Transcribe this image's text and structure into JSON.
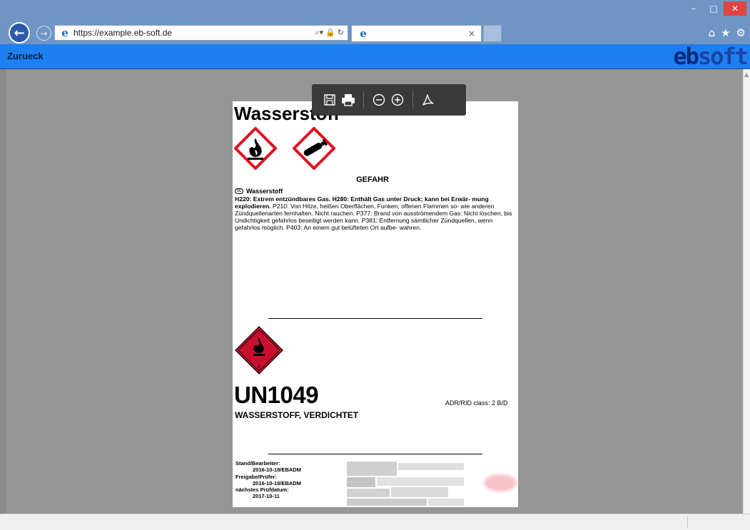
{
  "browser": {
    "url": "https://example.eb-soft.de",
    "tab_title": "",
    "window_buttons": {
      "minimize": "–",
      "maximize": "□",
      "close": "✕"
    },
    "tool_icons": [
      "home-icon",
      "star-icon",
      "gear-icon"
    ]
  },
  "app": {
    "back_label": "Zurueck",
    "brand": {
      "part1": "eb",
      "part2": "soft"
    },
    "accent_color": "#1e7ff0"
  },
  "pdf_toolbar": {
    "buttons": [
      "save-icon",
      "print-icon",
      "zoom-out-icon",
      "zoom-in-icon",
      "acrobat-icon"
    ]
  },
  "document": {
    "title": "Wasserstoff",
    "signal_word": "GEFAHR",
    "lang_badge": "DE",
    "substance": "Wasserstoff",
    "hazard_bold": "H220: Extrem entzündbares Gas. H280: Enthält Gas unter Druck; kann bei Erwär- mung explodieren.",
    "precautions": " P210: Von Hitze, heißen Oberflächen, Funken, offenen Flammen so- wie anderen Zündquellenarten fernhalten. Nicht rauchen. P377: Brand von ausströmendem Gas: Nicht löschen, bis Undichtigkeit gefahrlos beseitigt werden kann. P381: Entfernung sämtlicher Zündquellen, wenn gefahrlos möglich. P403: An einem gut belüfteten Ort aufbe- wahren.",
    "transport_class_number": "2",
    "un_number": "UN1049",
    "adr_class": "ADR/RID class: 2 B/D",
    "shipping_name": "WASSERSTOFF, VERDICHTET",
    "footer": {
      "stand_label": "Stand/Bearbeiter:",
      "stand_value": "2016-10-18/EBADM",
      "freigabe_label": "Freigabe/Prüfer:",
      "freigabe_value": "2016-10-18/EBADM",
      "next_label": "nächstes Prüfdatum:",
      "next_value": "2017-10-11"
    },
    "colors": {
      "ghs_red": "#e01020",
      "adr_red": "#c8102e"
    }
  }
}
